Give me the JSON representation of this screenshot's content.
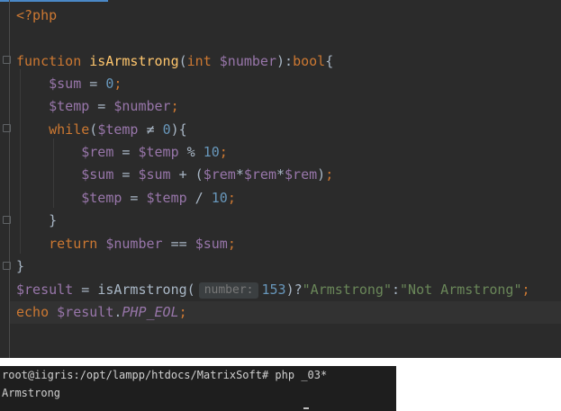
{
  "editor": {
    "lines": {
      "l1": {
        "open_tag": "<?php"
      },
      "l3": {
        "kw_function": "function",
        "fn_name": "isArmstrong",
        "open_paren": "(",
        "kw_int": "int",
        "var_number": "$number",
        "close_paren": "):",
        "kw_bool": "bool",
        "brace": "{"
      },
      "l4": {
        "var_sum": "$sum",
        "op": " = ",
        "num_zero": "0",
        "semi": ";"
      },
      "l5": {
        "var_temp": "$temp",
        "op": " = ",
        "var_number": "$number",
        "semi": ";"
      },
      "l6": {
        "kw_while": "while",
        "open": "(",
        "var_temp": "$temp",
        "op": " ≠ ",
        "num_zero": "0",
        "close": "){"
      },
      "l7": {
        "var_rem": "$rem",
        "op1": " = ",
        "var_temp": "$temp",
        "op2": " % ",
        "num_ten": "10",
        "semi": ";"
      },
      "l8": {
        "var_sum": "$sum",
        "op1": " = ",
        "var_sum2": "$sum",
        "op2": " + (",
        "var_rem1": "$rem",
        "star1": "*",
        "var_rem2": "$rem",
        "star2": "*",
        "var_rem3": "$rem",
        "close": ")",
        "semi": ";"
      },
      "l9": {
        "var_temp": "$temp",
        "op1": " = ",
        "var_temp2": "$temp",
        "op2": " / ",
        "num_ten": "10",
        "semi": ";"
      },
      "l10": {
        "brace": "}"
      },
      "l11": {
        "kw_return": "return",
        "var_number": "$number",
        "op": " == ",
        "var_sum": "$sum",
        "semi": ";"
      },
      "l12": {
        "brace": "}"
      },
      "l13": {
        "var_result": "$result",
        "op": " = ",
        "fn_call": "isArmstrong",
        "open": "(",
        "hint": "number:",
        "num_arg": "153",
        "close": ")?",
        "str1": "\"Armstrong\"",
        "colon": ":",
        "str2": "\"Not Armstrong\"",
        "semi": ";"
      },
      "l14": {
        "kw_echo": "echo",
        "var_result": "$result",
        "dot": ".",
        "const_eol": "PHP_EOL",
        "semi": ";"
      }
    }
  },
  "terminal": {
    "prompt_line": "root@iigris:/opt/lampp/htdocs/MatrixSoft# php _03*",
    "output_line": "Armstrong"
  }
}
